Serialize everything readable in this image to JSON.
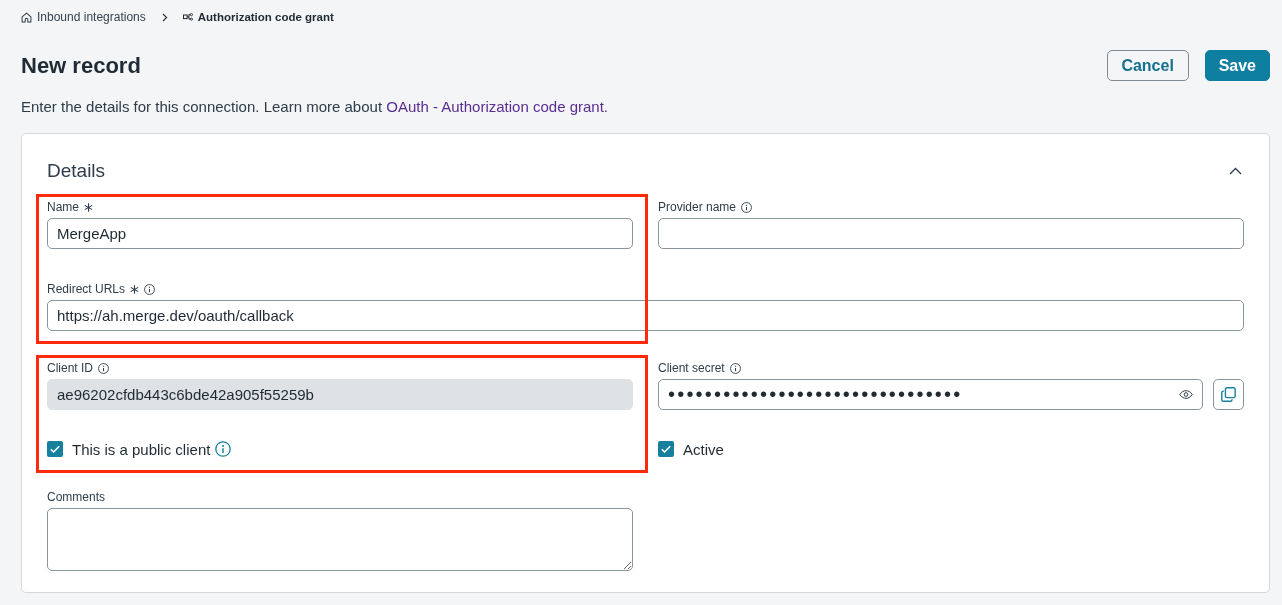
{
  "breadcrumb": [
    {
      "kind": "home",
      "label": "Inbound integrations"
    },
    {
      "kind": "current",
      "label": "Authorization code grant"
    }
  ],
  "header": {
    "title": "New record",
    "buttons": [
      {
        "kind": "secondary",
        "label": "Cancel"
      },
      {
        "kind": "primary",
        "label": "Save"
      }
    ]
  },
  "description": {
    "text": "Enter the details for this connection. Learn more about",
    "link": "OAuth - Authorization code grant."
  },
  "section": {
    "title": "Details",
    "expanded": true,
    "groups": [
      {
        "highlighted": true,
        "rows": [
          {
            "kind": "pair",
            "fields": [
              {
                "kind": "text",
                "label": "Name",
                "required": true,
                "info": false,
                "readonly": false,
                "value": "MergeApp"
              },
              {
                "kind": "text",
                "label": "Provider name",
                "required": false,
                "info": true,
                "readonly": false
              }
            ]
          },
          {
            "kind": "wide",
            "fields": [
              {
                "kind": "text",
                "label": "Redirect URLs",
                "required": true,
                "info": true,
                "readonly": false,
                "value": "https://ah.merge.dev/oauth/callback"
              }
            ]
          }
        ]
      },
      {
        "highlighted": true,
        "rows": [
          {
            "kind": "pair",
            "fields": [
              {
                "kind": "text",
                "label": "Client ID",
                "required": false,
                "info": true,
                "readonly": true,
                "value": "ae96202cfdb443c6bde42a905f55259b"
              },
              {
                "kind": "secret",
                "label": "Client secret",
                "required": false,
                "info": true,
                "value": "••••••••••••••••••••••••••••••••"
              }
            ]
          },
          {
            "kind": "pair",
            "fields": [
              {
                "kind": "checkbox",
                "label": "This is a public client",
                "checked": true,
                "info": true
              },
              {
                "kind": "checkbox",
                "label": "Active",
                "checked": true,
                "info": false
              }
            ]
          }
        ]
      },
      {
        "highlighted": false,
        "rows": [
          {
            "kind": "pair",
            "fields": [
              {
                "kind": "textarea",
                "label": "Comments",
                "required": false,
                "info": false
              }
            ]
          }
        ]
      }
    ]
  }
}
